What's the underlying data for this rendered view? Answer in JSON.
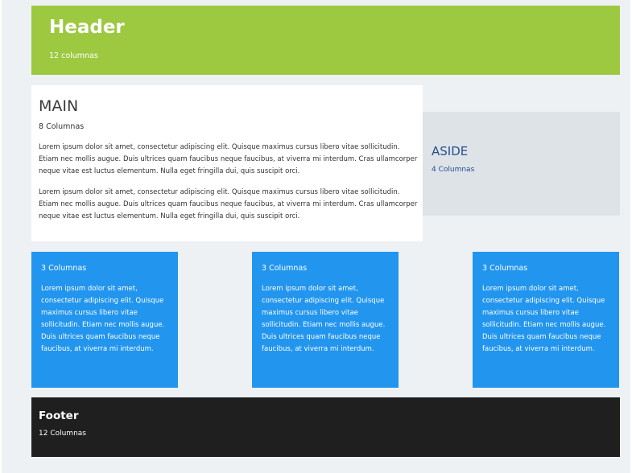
{
  "header": {
    "title": "Header",
    "subtitle": "12 columnas"
  },
  "main": {
    "title": "MAIN",
    "subtitle": "8 Columnas",
    "paragraphs": [
      "Lorem ipsum dolor sit amet, consectetur adipiscing elit. Quisque maximus cursus libero vitae sollicitudin. Etiam nec mollis augue. Duis ultrices quam faucibus neque faucibus, at viverra mi interdum. Cras ullamcorper neque vitae est luctus elementum. Nulla eget fringilla dui, quis suscipit orci.",
      "Lorem ipsum dolor sit amet, consectetur adipiscing elit. Quisque maximus cursus libero vitae sollicitudin. Etiam nec mollis augue. Duis ultrices quam faucibus neque faucibus, at viverra mi interdum. Cras ullamcorper neque vitae est luctus elementum. Nulla eget fringilla dui, quis suscipit orci."
    ]
  },
  "aside": {
    "title": "ASIDE",
    "subtitle": "4 Columnas"
  },
  "cards": [
    {
      "title": "3 Columnas",
      "text": "Lorem ipsum dolor sit amet, consectetur adipiscing elit. Quisque maximus cursus libero vitae sollicitudin. Etiam nec mollis augue. Duis ultrices quam faucibus neque faucibus, at viverra mi interdum."
    },
    {
      "title": "3 Columnas",
      "text": "Lorem ipsum dolor sit amet, consectetur adipiscing elit. Quisque maximus cursus libero vitae sollicitudin. Etiam nec mollis augue. Duis ultrices quam faucibus neque faucibus, at viverra mi interdum."
    },
    {
      "title": "3 Columnas",
      "text": "Lorem ipsum dolor sit amet, consectetur adipiscing elit. Quisque maximus cursus libero vitae sollicitudin. Etiam nec mollis augue. Duis ultrices quam faucibus neque faucibus, at viverra mi interdum."
    }
  ],
  "footer": {
    "title": "Footer",
    "subtitle": "12 Columnas"
  },
  "colors": {
    "header": "#9cc93f",
    "aside": "#dee3e8",
    "aside_text": "#254f8f",
    "card": "#2295ee",
    "footer": "#1f1f1f",
    "background": "#eef1f4"
  }
}
